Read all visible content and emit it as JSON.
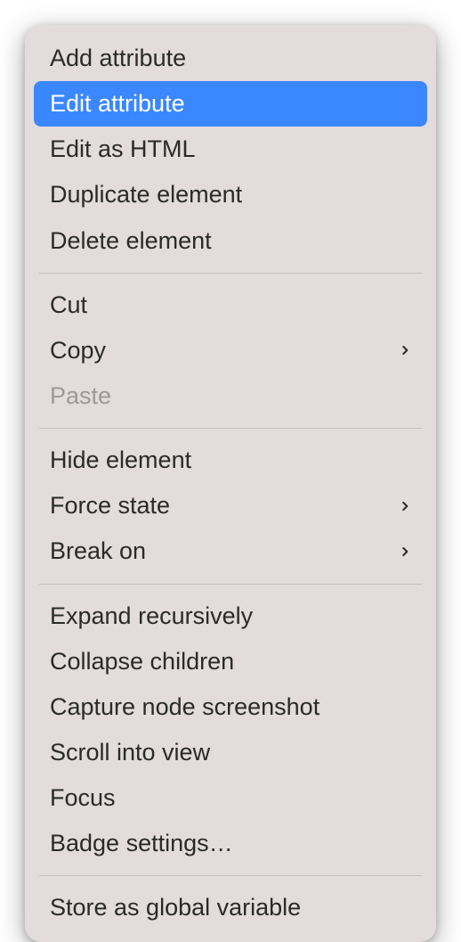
{
  "menu": {
    "groups": [
      [
        {
          "label": "Add attribute",
          "submenu": false,
          "disabled": false,
          "highlighted": false,
          "name": "menu-add-attribute"
        },
        {
          "label": "Edit attribute",
          "submenu": false,
          "disabled": false,
          "highlighted": true,
          "name": "menu-edit-attribute"
        },
        {
          "label": "Edit as HTML",
          "submenu": false,
          "disabled": false,
          "highlighted": false,
          "name": "menu-edit-as-html"
        },
        {
          "label": "Duplicate element",
          "submenu": false,
          "disabled": false,
          "highlighted": false,
          "name": "menu-duplicate-element"
        },
        {
          "label": "Delete element",
          "submenu": false,
          "disabled": false,
          "highlighted": false,
          "name": "menu-delete-element"
        }
      ],
      [
        {
          "label": "Cut",
          "submenu": false,
          "disabled": false,
          "highlighted": false,
          "name": "menu-cut"
        },
        {
          "label": "Copy",
          "submenu": true,
          "disabled": false,
          "highlighted": false,
          "name": "menu-copy"
        },
        {
          "label": "Paste",
          "submenu": false,
          "disabled": true,
          "highlighted": false,
          "name": "menu-paste"
        }
      ],
      [
        {
          "label": "Hide element",
          "submenu": false,
          "disabled": false,
          "highlighted": false,
          "name": "menu-hide-element"
        },
        {
          "label": "Force state",
          "submenu": true,
          "disabled": false,
          "highlighted": false,
          "name": "menu-force-state"
        },
        {
          "label": "Break on",
          "submenu": true,
          "disabled": false,
          "highlighted": false,
          "name": "menu-break-on"
        }
      ],
      [
        {
          "label": "Expand recursively",
          "submenu": false,
          "disabled": false,
          "highlighted": false,
          "name": "menu-expand-recursively"
        },
        {
          "label": "Collapse children",
          "submenu": false,
          "disabled": false,
          "highlighted": false,
          "name": "menu-collapse-children"
        },
        {
          "label": "Capture node screenshot",
          "submenu": false,
          "disabled": false,
          "highlighted": false,
          "name": "menu-capture-node-screenshot"
        },
        {
          "label": "Scroll into view",
          "submenu": false,
          "disabled": false,
          "highlighted": false,
          "name": "menu-scroll-into-view"
        },
        {
          "label": "Focus",
          "submenu": false,
          "disabled": false,
          "highlighted": false,
          "name": "menu-focus"
        },
        {
          "label": "Badge settings…",
          "submenu": false,
          "disabled": false,
          "highlighted": false,
          "name": "menu-badge-settings"
        }
      ],
      [
        {
          "label": "Store as global variable",
          "submenu": false,
          "disabled": false,
          "highlighted": false,
          "name": "menu-store-as-global-variable"
        }
      ]
    ]
  }
}
